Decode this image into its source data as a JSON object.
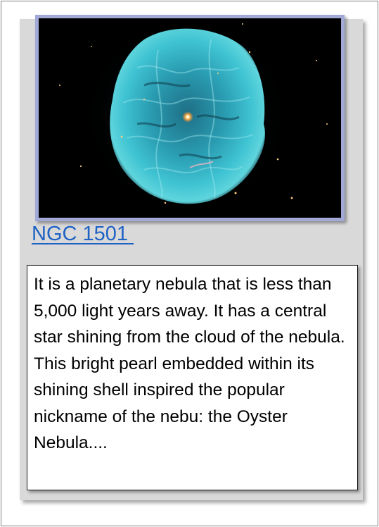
{
  "card": {
    "image_alt": "NGC 1501 planetary nebula",
    "title": "NGC 1501 ",
    "description": "It is a planetary nebula that is less than 5,000 light years away. It has a central star shining from the cloud of the nebula. This bright pearl embedded within its shining shell inspired the popular nickname of the nebu: the Oyster Nebula...."
  },
  "colors": {
    "card_background": "#d9d9d9",
    "image_border": "#a3a9d6",
    "link": "#1f62c4",
    "nebula": "#38b7c8"
  }
}
